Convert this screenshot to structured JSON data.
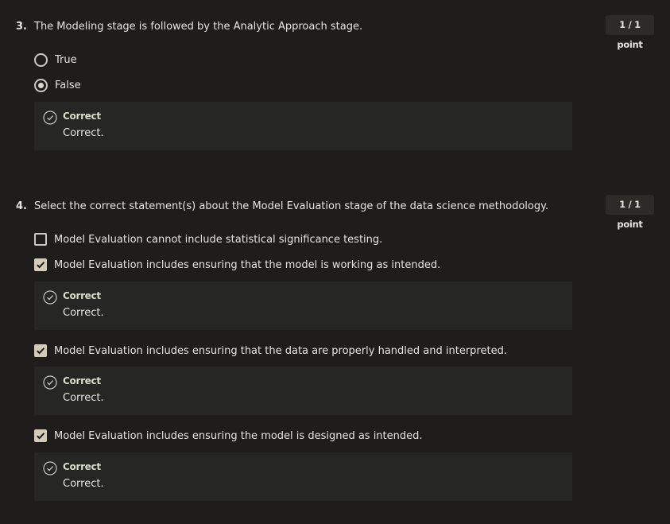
{
  "q3": {
    "number": "3.",
    "text": "The Modeling stage is followed by the Analytic Approach stage.",
    "points": "1 / 1 point",
    "options": [
      {
        "label": "True",
        "selected": false
      },
      {
        "label": "False",
        "selected": true
      }
    ],
    "feedback": {
      "title": "Correct",
      "text": "Correct."
    }
  },
  "q4": {
    "number": "4.",
    "text": "Select the correct statement(s) about the Model Evaluation stage of the data science methodology.",
    "points": "1 / 1 point",
    "options": [
      {
        "label": "Model Evaluation cannot include statistical significance testing.",
        "checked": false
      },
      {
        "label": "Model Evaluation includes ensuring that the model is working as intended.",
        "checked": true,
        "feedback": {
          "title": "Correct",
          "text": "Correct."
        }
      },
      {
        "label": "Model Evaluation includes ensuring that the data are properly handled and interpreted.",
        "checked": true,
        "feedback": {
          "title": "Correct",
          "text": "Correct."
        }
      },
      {
        "label": "Model Evaluation includes ensuring the model is designed as intended.",
        "checked": true,
        "feedback": {
          "title": "Correct",
          "text": "Correct."
        }
      }
    ]
  },
  "colors": {
    "background": "#1e1d1b",
    "feedback_background": "#262724",
    "correct_green": "#d6dcc6",
    "checkbox_fill": "#d3cbb8"
  }
}
